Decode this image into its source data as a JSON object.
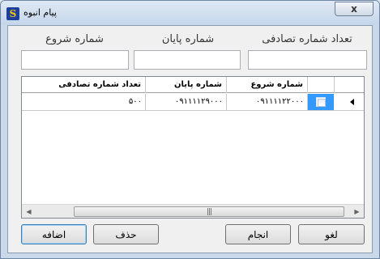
{
  "window": {
    "title": "پیام انبوه",
    "close_label": "x"
  },
  "fields": {
    "random_count_label": "تعداد شماره تصادفی",
    "end_number_label": "شماره پایان",
    "start_number_label": "شماره شروع",
    "random_count_value": "",
    "end_number_value": "",
    "start_number_value": ""
  },
  "grid": {
    "columns": [
      "تعداد شماره تصادفی",
      "شماره پایان",
      "شماره شروع"
    ],
    "rows": [
      {
        "random_count": "۵۰۰",
        "end_number": "۰۹۱۱۱۱۲۹۰۰۰",
        "start_number": "۰۹۱۱۱۱۲۲۰۰۰",
        "selected": false
      }
    ],
    "scroll_grip": "|||"
  },
  "buttons": {
    "add": "اضافه",
    "delete": "حذف",
    "done": "انجام",
    "cancel": "لغو"
  }
}
